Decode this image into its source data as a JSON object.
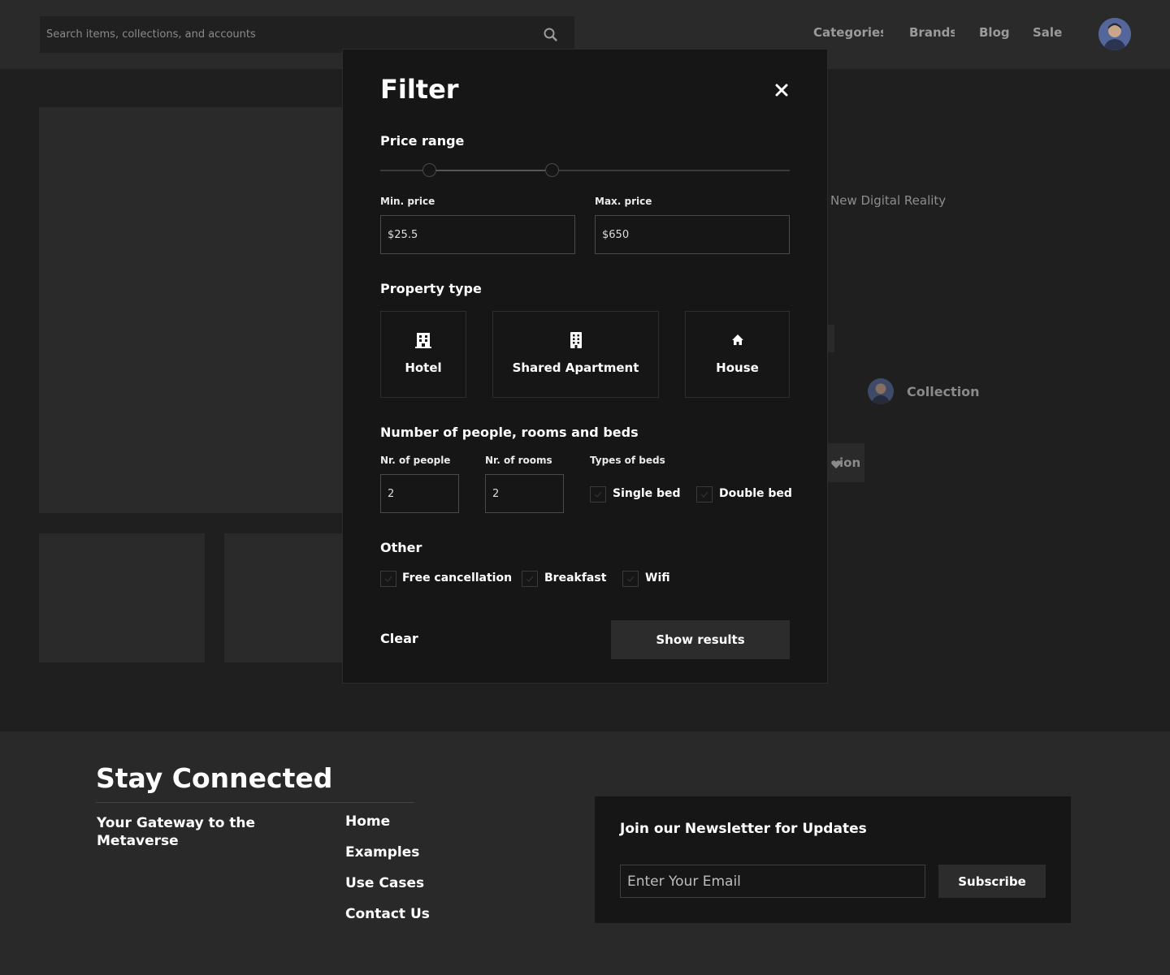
{
  "header": {
    "search_placeholder": "Search items, collections, and accounts",
    "nav": [
      "Categories",
      "Brands",
      "Blog",
      "Sale"
    ]
  },
  "background": {
    "subtitle": "New Digital Reality",
    "collection_label": "Collection",
    "partial_button": "ion"
  },
  "filter": {
    "title": "Filter",
    "price_range": {
      "heading": "Price range",
      "min_label": "Min. price",
      "max_label": "Max. price",
      "min_value": "$25.5",
      "max_value": "$650",
      "slider_low_fraction": 0.12,
      "slider_high_fraction": 0.42
    },
    "property_type": {
      "heading": "Property type",
      "options": [
        {
          "label": "Hotel",
          "icon": "hotel-icon"
        },
        {
          "label": "Shared Apartment",
          "icon": "apartment-icon"
        },
        {
          "label": "House",
          "icon": "house-icon"
        }
      ]
    },
    "people": {
      "heading": "Number of people, rooms and beds",
      "people_label": "Nr. of people",
      "people_value": "2",
      "rooms_label": "Nr. of rooms",
      "rooms_value": "2",
      "beds_label": "Types of beds",
      "beds": [
        "Single bed",
        "Double bed"
      ]
    },
    "other": {
      "heading": "Other",
      "options": [
        "Free cancellation",
        "Breakfast",
        "Wifi"
      ]
    },
    "clear_label": "Clear",
    "show_label": "Show results"
  },
  "footer": {
    "title": "Stay Connected",
    "tagline": "Your Gateway to the Metaverse",
    "links": [
      "Home",
      "Examples",
      "Use Cases",
      "Contact Us"
    ],
    "newsletter_title": "Join our Newsletter for Updates",
    "email_placeholder": "Enter Your Email",
    "subscribe_label": "Subscribe"
  },
  "colors": {
    "page_bg": "#1f1f1f",
    "panel_bg": "#2a2a2a",
    "modal_bg": "#161616",
    "text": "#ffffff",
    "muted_text": "#9a9a9a"
  }
}
